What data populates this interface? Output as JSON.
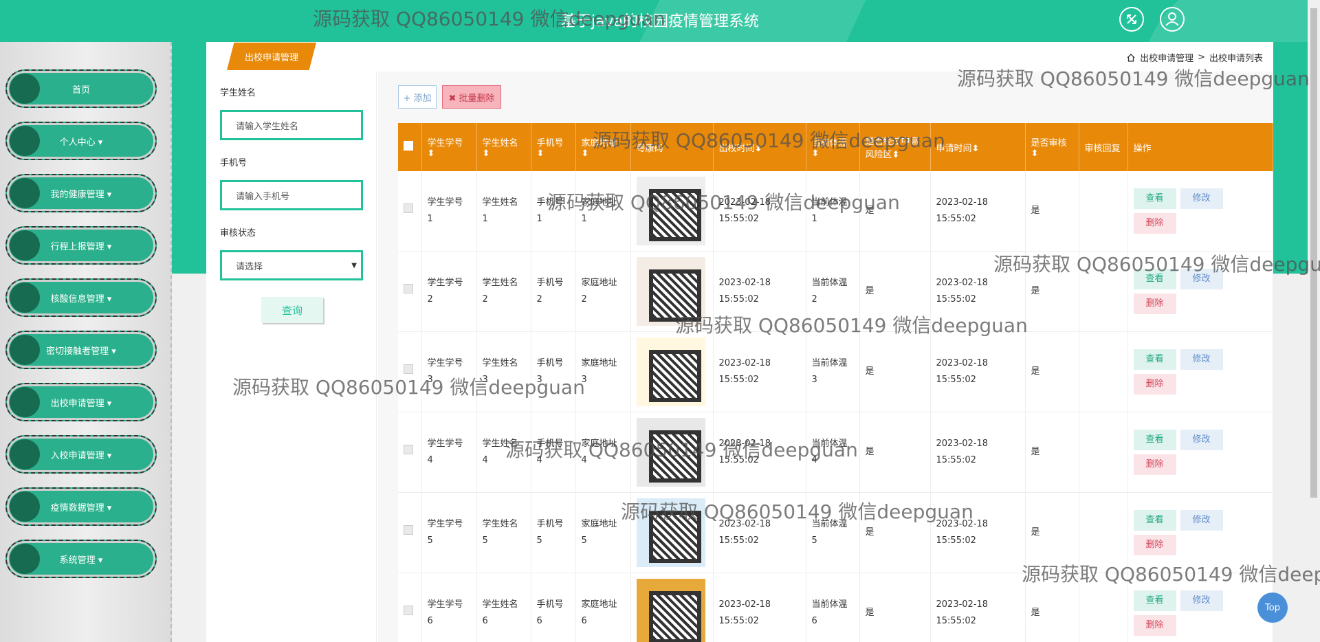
{
  "app": {
    "title": "基于java的校园疫情管理系统"
  },
  "header": {
    "fullscreen_icon": "fullscreen-icon",
    "user_icon": "user-icon"
  },
  "sidebar": {
    "items": [
      {
        "label": "首页"
      },
      {
        "label": "个人中心 ▾"
      },
      {
        "label": "我的健康管理 ▾"
      },
      {
        "label": "行程上报管理 ▾"
      },
      {
        "label": "核酸信息管理 ▾"
      },
      {
        "label": "密切接触者管理 ▾"
      },
      {
        "label": "出校申请管理 ▾"
      },
      {
        "label": "入校申请管理 ▾"
      },
      {
        "label": "疫情数据管理 ▾"
      },
      {
        "label": "系统管理 ▾"
      }
    ]
  },
  "page": {
    "tag": "出校申请管理",
    "breadcrumb": {
      "home": "出校申请管理",
      "separator": ">",
      "current": "出校申请列表"
    }
  },
  "filters": {
    "name_label": "学生姓名",
    "name_placeholder": "请输入学生姓名",
    "phone_label": "手机号",
    "phone_placeholder": "请输入手机号",
    "status_label": "审核状态",
    "status_value": "请选择",
    "query_label": "查询"
  },
  "toolbar": {
    "add_label": "+ 添加",
    "bulk_delete_label": "✖ 批量删除"
  },
  "table": {
    "headers": [
      "学生学号 ⬍",
      "学生姓名 ⬍",
      "手机号 ⬍",
      "家庭地址 ⬍",
      "粤康码",
      "出校时间⬍",
      "当前体温 ⬍",
      "是否经过中高风险区⬍",
      "申请时间⬍",
      "是否审核 ⬍",
      "审核回复",
      "操作"
    ],
    "rows": [
      {
        "id": "学生学号 1",
        "name": "学生姓名 1",
        "phone": "手机号 1",
        "addr": "家庭地址 1",
        "out_time": "2023-02-18 15:55:02",
        "temp": "当前体温 1",
        "risk": "是",
        "apply_time": "2023-02-18 15:55:02",
        "audited": "是",
        "reply": ""
      },
      {
        "id": "学生学号 2",
        "name": "学生姓名 2",
        "phone": "手机号 2",
        "addr": "家庭地址 2",
        "out_time": "2023-02-18 15:55:02",
        "temp": "当前体温 2",
        "risk": "是",
        "apply_time": "2023-02-18 15:55:02",
        "audited": "是",
        "reply": ""
      },
      {
        "id": "学生学号 3",
        "name": "学生姓名 3",
        "phone": "手机号 3",
        "addr": "家庭地址 3",
        "out_time": "2023-02-18 15:55:02",
        "temp": "当前体温 3",
        "risk": "是",
        "apply_time": "2023-02-18 15:55:02",
        "audited": "是",
        "reply": ""
      },
      {
        "id": "学生学号 4",
        "name": "学生姓名 4",
        "phone": "手机号 4",
        "addr": "家庭地址 4",
        "out_time": "2023-02-18 15:55:02",
        "temp": "当前体温 4",
        "risk": "是",
        "apply_time": "2023-02-18 15:55:02",
        "audited": "是",
        "reply": ""
      },
      {
        "id": "学生学号 5",
        "name": "学生姓名 5",
        "phone": "手机号 5",
        "addr": "家庭地址 5",
        "out_time": "2023-02-18 15:55:02",
        "temp": "当前体温 5",
        "risk": "是",
        "apply_time": "2023-02-18 15:55:02",
        "audited": "是",
        "reply": ""
      },
      {
        "id": "学生学号 6",
        "name": "学生姓名 6",
        "phone": "手机号 6",
        "addr": "家庭地址 6",
        "out_time": "2023-02-18 15:55:02",
        "temp": "当前体温 6",
        "risk": "是",
        "apply_time": "2023-02-18 15:55:02",
        "audited": "是",
        "reply": ""
      }
    ],
    "actions": {
      "view": "查看",
      "edit": "修改",
      "delete": "删除"
    }
  },
  "top_button": "Top",
  "watermark": "源码获取 QQ86050149 微信deepguan",
  "colors": {
    "primary": "#21c29a",
    "accent": "#e8890a",
    "danger": "#d24a5d"
  }
}
